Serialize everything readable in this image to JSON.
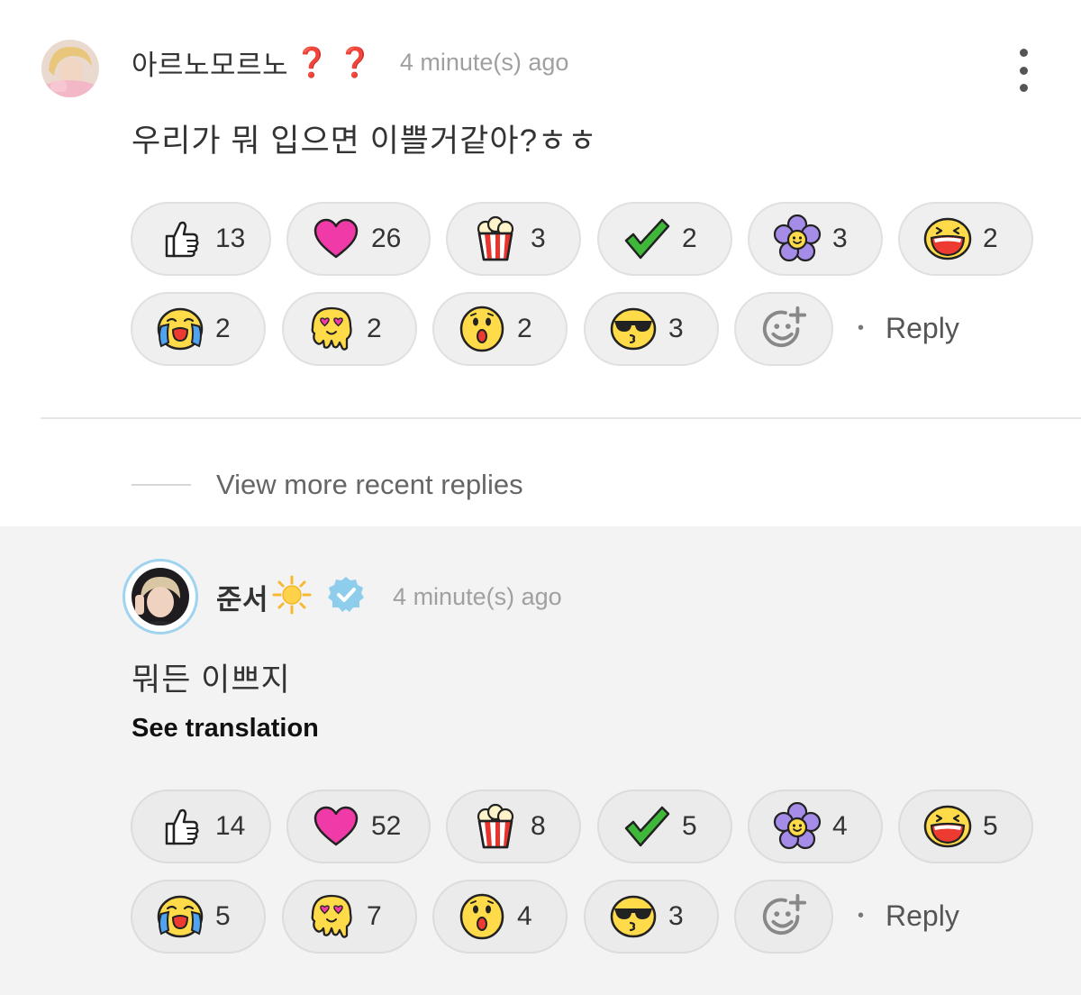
{
  "comments": [
    {
      "username": "아르노모르노",
      "username_icons": [
        "❓",
        "❓"
      ],
      "timestamp": "4 minute(s) ago",
      "body": "우리가 뭐 입으면 이쁠거같아?ㅎㅎ",
      "reactions": [
        {
          "icon": "thumbs-up-icon",
          "count": "13"
        },
        {
          "icon": "heart-icon",
          "count": "26"
        },
        {
          "icon": "popcorn-icon",
          "count": "3"
        },
        {
          "icon": "check-icon",
          "count": "2"
        },
        {
          "icon": "flower-icon",
          "count": "3"
        },
        {
          "icon": "laughing-face-icon",
          "count": "2"
        },
        {
          "icon": "crying-face-icon",
          "count": "2"
        },
        {
          "icon": "heart-eyes-melting-icon",
          "count": "2"
        },
        {
          "icon": "surprised-face-icon",
          "count": "2"
        },
        {
          "icon": "sunglasses-kiss-icon",
          "count": "3"
        }
      ],
      "reply_label": "Reply"
    },
    {
      "username": "준서",
      "username_icons": [
        "sun-icon",
        "verified-badge-icon"
      ],
      "timestamp": "4 minute(s) ago",
      "body": "뭐든 이쁘지",
      "see_translation": "See translation",
      "reactions": [
        {
          "icon": "thumbs-up-icon",
          "count": "14"
        },
        {
          "icon": "heart-icon",
          "count": "52"
        },
        {
          "icon": "popcorn-icon",
          "count": "8"
        },
        {
          "icon": "check-icon",
          "count": "5"
        },
        {
          "icon": "flower-icon",
          "count": "4"
        },
        {
          "icon": "laughing-face-icon",
          "count": "5"
        },
        {
          "icon": "crying-face-icon",
          "count": "5"
        },
        {
          "icon": "heart-eyes-melting-icon",
          "count": "7"
        },
        {
          "icon": "surprised-face-icon",
          "count": "4"
        },
        {
          "icon": "sunglasses-kiss-icon",
          "count": "3"
        }
      ],
      "reply_label": "Reply"
    }
  ],
  "view_more_replies": "View more recent replies",
  "colors": {
    "question_mark": "#d92a1e",
    "verified_badge": "#8fcdec",
    "heart": "#f03aa8",
    "check": "#3fb83a",
    "flower": "#a58ce8",
    "emoji_yellow": "#ffdb4a"
  }
}
